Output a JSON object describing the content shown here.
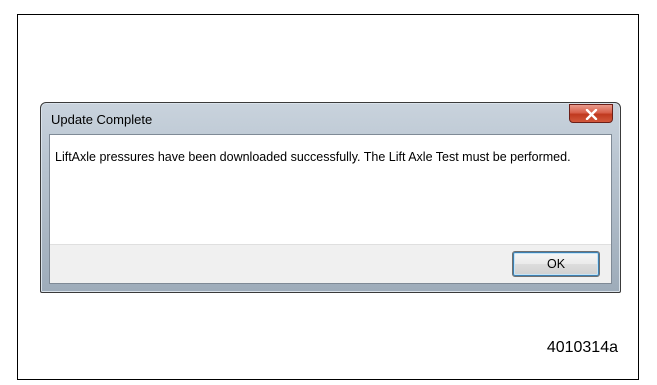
{
  "dialog": {
    "title": "Update Complete",
    "close_icon": "close-icon",
    "message": "LiftAxle pressures have been downloaded successfully.  The Lift Axle Test must be performed.",
    "ok_label": "OK"
  },
  "figure": {
    "id": "4010314a"
  },
  "colors": {
    "close_button": "#c84a33",
    "button_strip": "#f0f0f0",
    "frame_border": "#000000"
  }
}
